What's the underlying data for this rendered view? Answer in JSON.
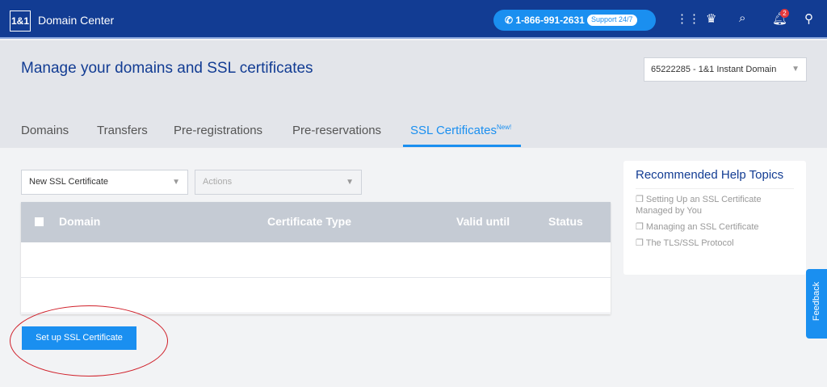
{
  "header": {
    "logo": "1&1",
    "app_name": "Domain Center",
    "phone": "1-866-991-2631",
    "support": "Support 24/7",
    "notifications": "2"
  },
  "page": {
    "title": "Manage your domains and SSL certificates",
    "account": "65222285 - 1&1 Instant Domain"
  },
  "tabs": [
    {
      "label": "Domains"
    },
    {
      "label": "Transfers"
    },
    {
      "label": "Pre-registrations"
    },
    {
      "label": "Pre-reservations"
    },
    {
      "label": "SSL Certificates",
      "badge": "New!"
    }
  ],
  "filters": {
    "type": "New SSL Certificate",
    "actions": "Actions"
  },
  "table": {
    "columns": [
      "Domain",
      "Certificate Type",
      "Valid until",
      "Status"
    ]
  },
  "setup_button": "Set up SSL Certificate",
  "help": {
    "title": "Recommended Help Topics",
    "links": [
      "Setting Up an SSL Certificate Managed by You",
      "Managing an SSL Certificate",
      "The TLS/SSL Protocol"
    ]
  },
  "feedback": "Feedback"
}
